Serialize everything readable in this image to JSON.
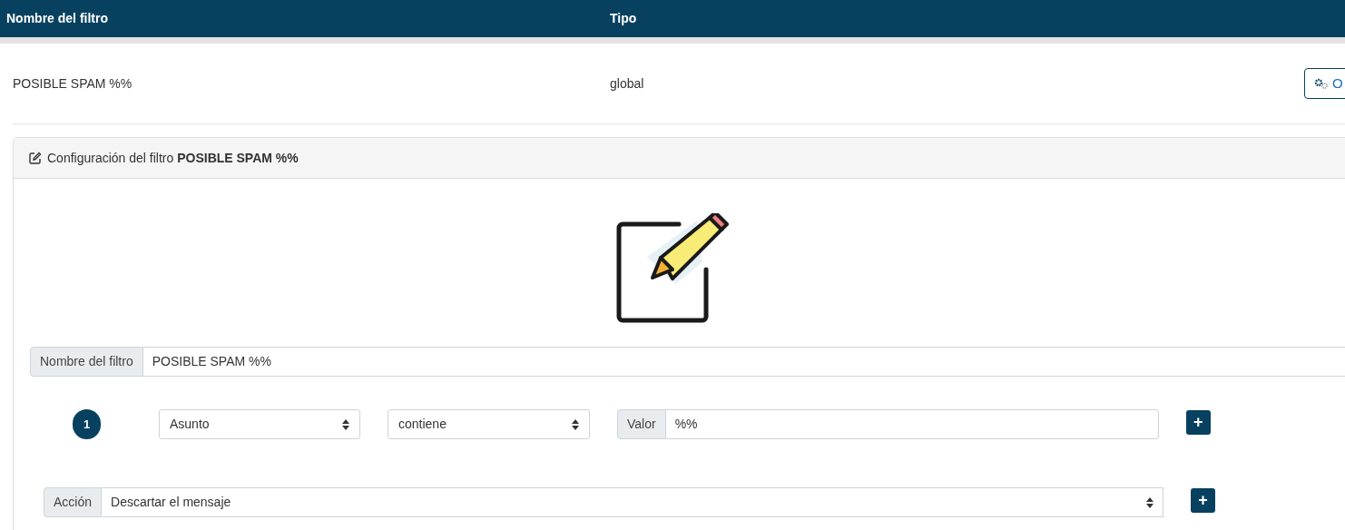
{
  "table": {
    "columns": [
      "Nombre del filtro",
      "Tipo"
    ],
    "rows": [
      {
        "name": "POSIBLE SPAM %%",
        "type": "global",
        "button": "O"
      }
    ]
  },
  "panel": {
    "title": "Configuración del filtro **POSIBLE SPAM %%**",
    "name_field": {
      "label": "Nombre del filtro",
      "value": "POSIBLE SPAM %%"
    },
    "conditions": [
      {
        "number": "1",
        "field": "Asunto",
        "operator": "contiene",
        "value_label": "Valor",
        "value": "%%",
        "add_button": "+"
      }
    ],
    "action": {
      "label": "Acción",
      "value": "Descartar el mensaje",
      "add_button": "+"
    }
  }
}
